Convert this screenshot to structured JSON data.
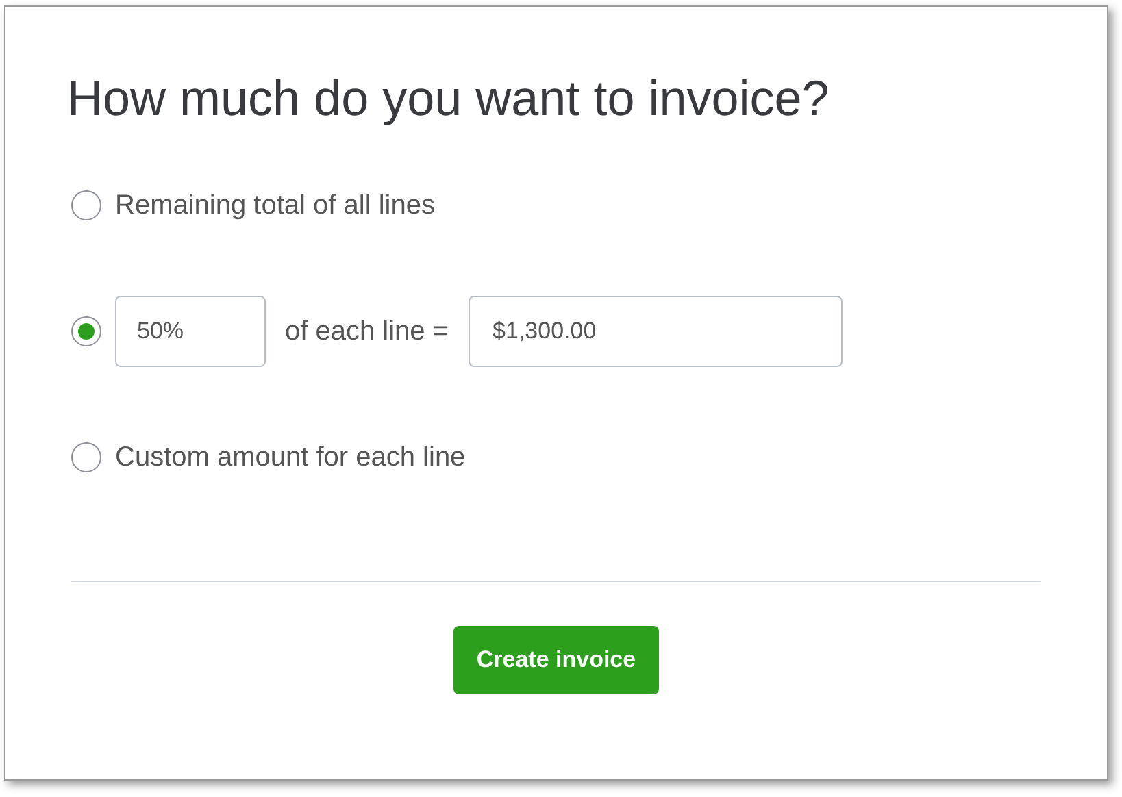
{
  "title": "How much do you want to invoice?",
  "options": [
    {
      "kind": "text",
      "label": "Remaining total of all lines",
      "selected": false
    },
    {
      "kind": "percent",
      "selected": true,
      "percent": "50%",
      "middle": "of each line =",
      "amount": "$1,300.00"
    },
    {
      "kind": "text",
      "label": "Custom amount for each line",
      "selected": false
    }
  ],
  "button": "Create invoice"
}
